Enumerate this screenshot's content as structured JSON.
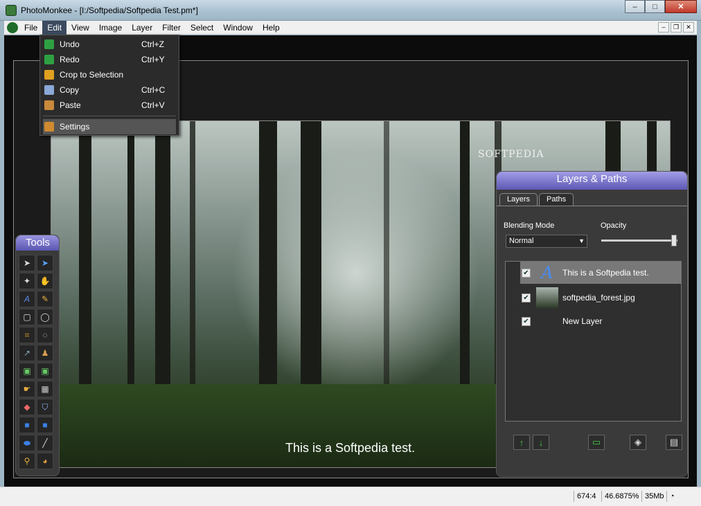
{
  "window": {
    "title": "PhotoMonkee - [I:/Softpedia/Softpedia Test.pm*]",
    "minimize": "–",
    "maximize": "□",
    "close": "✕"
  },
  "menubar": {
    "items": [
      "File",
      "Edit",
      "View",
      "Image",
      "Layer",
      "Filter",
      "Select",
      "Window",
      "Help"
    ],
    "active": "Edit"
  },
  "mdi": {
    "minimize": "–",
    "restore": "❐",
    "close": "✕"
  },
  "edit_menu": {
    "items": [
      {
        "label": "Undo",
        "shortcut": "Ctrl+Z",
        "icon": "undo-icon",
        "color": "#2ea043"
      },
      {
        "label": "Redo",
        "shortcut": "Ctrl+Y",
        "icon": "redo-icon",
        "color": "#2ea043"
      },
      {
        "label": "Crop to Selection",
        "shortcut": "",
        "icon": "crop-icon",
        "color": "#e0a020"
      },
      {
        "label": "Copy",
        "shortcut": "Ctrl+C",
        "icon": "copy-icon",
        "color": "#8aa8d8"
      },
      {
        "label": "Paste",
        "shortcut": "Ctrl+V",
        "icon": "paste-icon",
        "color": "#c88a3a"
      }
    ],
    "settings": {
      "label": "Settings",
      "icon": "wrench-icon",
      "color": "#d08a30"
    }
  },
  "canvas": {
    "watermark": "SOFTPEDIA",
    "caption": "This is a Softpedia test."
  },
  "tools": {
    "title": "Tools"
  },
  "panel": {
    "title": "Layers & Paths",
    "tabs": [
      "Layers",
      "Paths"
    ],
    "blending_label": "Blending Mode",
    "blending_value": "Normal",
    "opacity_label": "Opacity",
    "opacity": 0.95,
    "layers": [
      {
        "name": "This is a Softpedia test.",
        "checked": true,
        "thumb": "text-layer-icon",
        "selected": true
      },
      {
        "name": "softpedia_forest.jpg",
        "checked": true,
        "thumb": "image-thumb",
        "selected": false
      },
      {
        "name": "New Layer",
        "checked": true,
        "thumb": "",
        "selected": false
      }
    ]
  },
  "status": {
    "coords": "674:4",
    "zoom": "46.6875%",
    "memory": "35Mb"
  }
}
